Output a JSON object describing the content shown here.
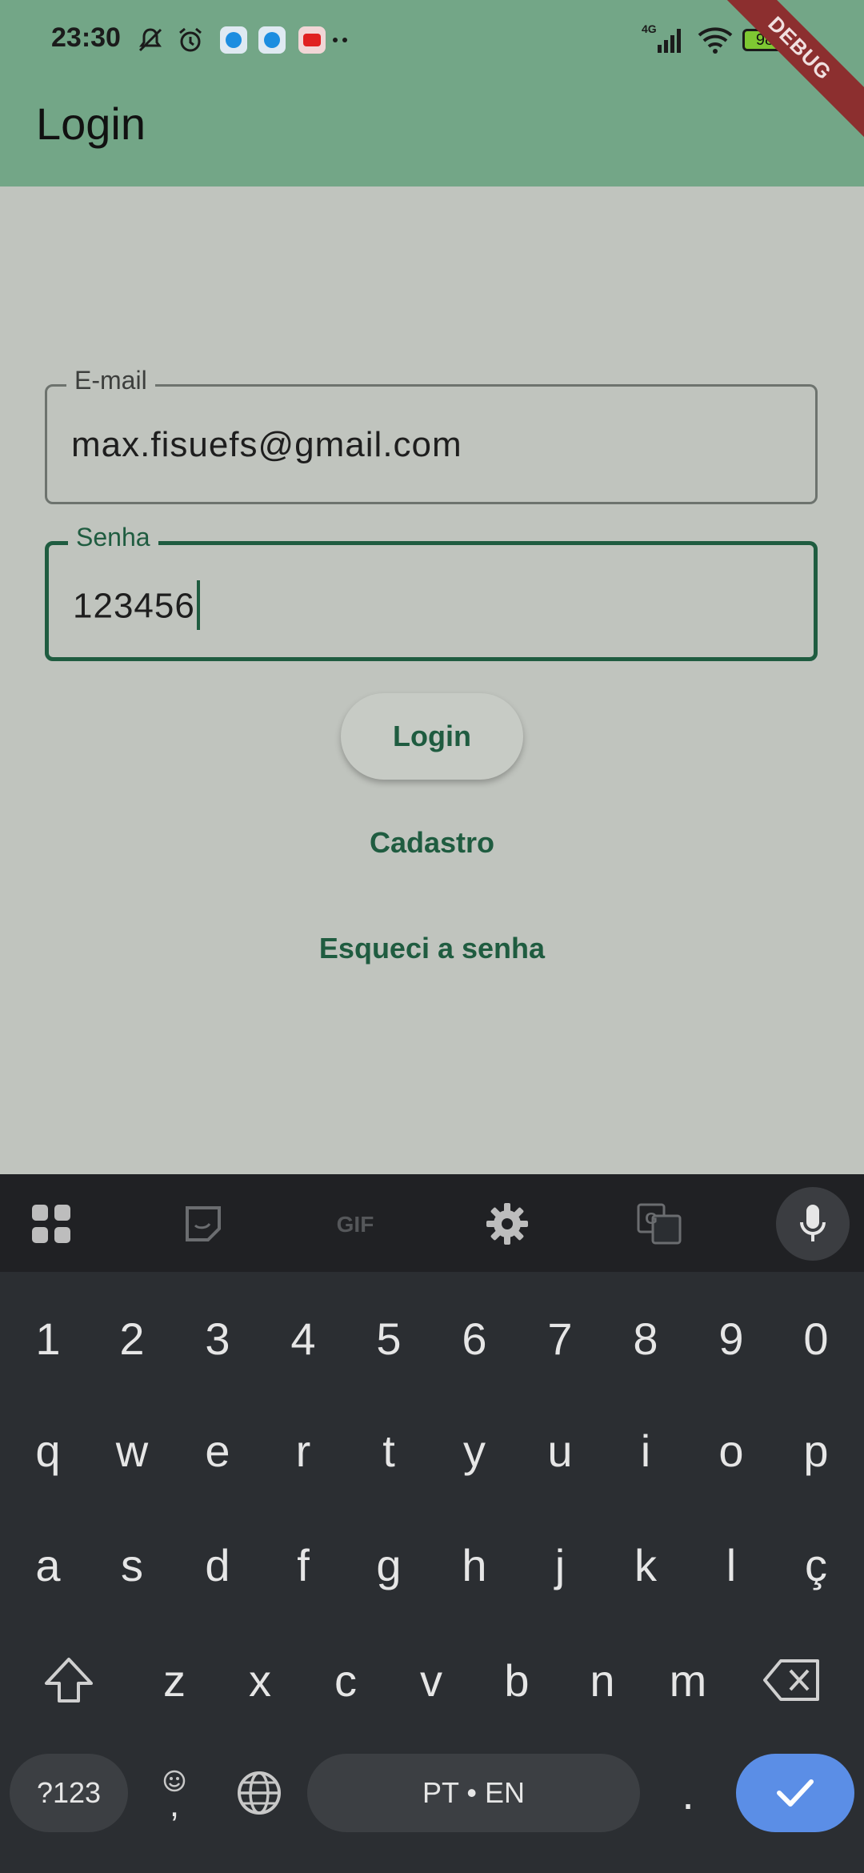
{
  "status_bar": {
    "time": "23:30",
    "network": "4G",
    "battery": "98"
  },
  "debug_banner": "DEBUG",
  "app_bar": {
    "title": "Login"
  },
  "form": {
    "email": {
      "label": "E-mail",
      "value": "max.fisuefs@gmail.com"
    },
    "password": {
      "label": "Senha",
      "value": "123456"
    },
    "login_button": "Login",
    "signup_link": "Cadastro",
    "forgot_link": "Esqueci a senha"
  },
  "keyboard": {
    "row_numbers": [
      "1",
      "2",
      "3",
      "4",
      "5",
      "6",
      "7",
      "8",
      "9",
      "0"
    ],
    "row1": [
      "q",
      "w",
      "e",
      "r",
      "t",
      "y",
      "u",
      "i",
      "o",
      "p"
    ],
    "row2": [
      "a",
      "s",
      "d",
      "f",
      "g",
      "h",
      "j",
      "k",
      "l",
      "ç"
    ],
    "row3": [
      "z",
      "x",
      "c",
      "v",
      "b",
      "n",
      "m"
    ],
    "symbols_key": "?123",
    "comma_key": ",",
    "space_label": "PT • EN",
    "period_key": ".",
    "colors": {
      "background": "#2b2e32",
      "enter": "#5b8ee6"
    }
  },
  "colors": {
    "app_bar": "#73a687",
    "background": "#c0c4be",
    "accent": "#1f5c40"
  }
}
